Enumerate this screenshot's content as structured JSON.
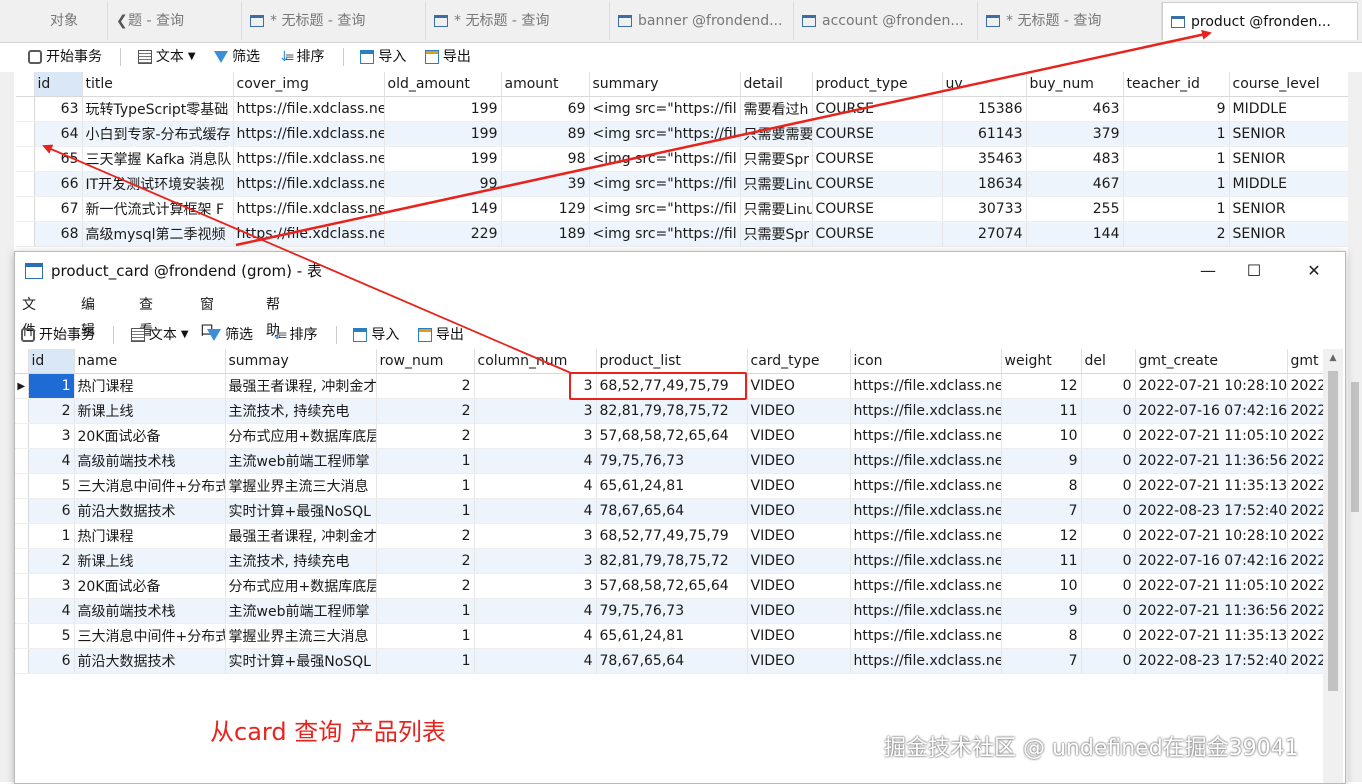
{
  "tabs": [
    {
      "label": "对象"
    },
    {
      "label": "题 - 查询"
    },
    {
      "label": "* 无标题 - 查询"
    },
    {
      "label": "* 无标题 - 查询"
    },
    {
      "label": "banner @frondend..."
    },
    {
      "label": "account @fronden..."
    },
    {
      "label": "* 无标题 - 查询"
    },
    {
      "label": "product @fronden..."
    }
  ],
  "toolbar": {
    "begin": "开始事务",
    "text": "文本",
    "filter": "筛选",
    "sort": "排序",
    "import": "导入",
    "export": "导出"
  },
  "product_table": {
    "columns": [
      "id",
      "title",
      "cover_img",
      "old_amount",
      "amount",
      "summary",
      "detail",
      "product_type",
      "uv",
      "buy_num",
      "teacher_id",
      "course_level"
    ],
    "rows": [
      [
        "63",
        "玩转TypeScript零基础",
        "https://file.xdclass.ne",
        "199",
        "69",
        "<img src=\"https://fil",
        "需要看过h",
        "COURSE",
        "15386",
        "463",
        "9",
        "MIDDLE"
      ],
      [
        "64",
        "小白到专家-分布式缓存",
        "https://file.xdclass.ne",
        "199",
        "89",
        "<img src=\"https://fil",
        "只需要需要看",
        "COURSE",
        "61143",
        "379",
        "1",
        "SENIOR"
      ],
      [
        "65",
        "三天掌握 Kafka 消息队",
        "https://file.xdclass.ne",
        "199",
        "98",
        "<img src=\"https://fil",
        "只需要Spr",
        "COURSE",
        "35463",
        "483",
        "1",
        "SENIOR"
      ],
      [
        "66",
        "IT开发测试环境安装视",
        "https://file.xdclass.ne",
        "99",
        "39",
        "<img src=\"https://fil",
        "只需要Linu",
        "COURSE",
        "18634",
        "467",
        "1",
        "MIDDLE"
      ],
      [
        "67",
        "新一代流式计算框架 F",
        "https://file.xdclass.ne",
        "149",
        "129",
        "<img src=\"https://fil",
        "只需要Linu",
        "COURSE",
        "30733",
        "255",
        "1",
        "SENIOR"
      ],
      [
        "68",
        "高级mysql第二季视频",
        "https://file.xdclass.ne",
        "229",
        "189",
        "<img src=\"https://fil",
        "只需要Spr",
        "COURSE",
        "27074",
        "144",
        "2",
        "SENIOR"
      ]
    ]
  },
  "window": {
    "title": "product_card @frondend (grom) - 表",
    "menu": [
      "文件",
      "编辑",
      "查看",
      "窗口",
      "帮助"
    ],
    "controls": {
      "minimize": "—",
      "maximize": "☐",
      "close": "✕"
    }
  },
  "card_table": {
    "columns": [
      "id",
      "name",
      "summay",
      "row_num",
      "column_num",
      "product_list",
      "card_type",
      "icon",
      "weight",
      "del",
      "gmt_create",
      "gmt"
    ],
    "rows": [
      [
        "1",
        "热门课程",
        "最强王者课程, 冲刺金才",
        "2",
        "3",
        "68,52,77,49,75,79",
        "VIDEO",
        "https://file.xdclass.ne",
        "12",
        "0",
        "2022-07-21 10:28:10",
        "2022"
      ],
      [
        "2",
        "新课上线",
        "主流技术, 持续充电",
        "2",
        "3",
        "82,81,79,78,75,72",
        "VIDEO",
        "https://file.xdclass.ne",
        "11",
        "0",
        "2022-07-16 07:42:16",
        "2022"
      ],
      [
        "3",
        "20K面试必备",
        "分布式应用+数据库底层",
        "2",
        "3",
        "57,68,58,72,65,64",
        "VIDEO",
        "https://file.xdclass.ne",
        "10",
        "0",
        "2022-07-21 11:05:10",
        "2022"
      ],
      [
        "4",
        "高级前端技术栈",
        "主流web前端工程师掌",
        "1",
        "4",
        "79,75,76,73",
        "VIDEO",
        "https://file.xdclass.ne",
        "9",
        "0",
        "2022-07-21 11:36:56",
        "2022"
      ],
      [
        "5",
        "三大消息中间件+分布式",
        "掌握业界主流三大消息",
        "1",
        "4",
        "65,61,24,81",
        "VIDEO",
        "https://file.xdclass.ne",
        "8",
        "0",
        "2022-07-21 11:35:13",
        "2022"
      ],
      [
        "6",
        "前沿大数据技术",
        "实时计算+最强NoSQL",
        "1",
        "4",
        "78,67,65,64",
        "VIDEO",
        "https://file.xdclass.ne",
        "7",
        "0",
        "2022-08-23 17:52:40",
        "2022"
      ],
      [
        "1",
        "热门课程",
        "最强王者课程, 冲刺金才",
        "2",
        "3",
        "68,52,77,49,75,79",
        "VIDEO",
        "https://file.xdclass.ne",
        "12",
        "0",
        "2022-07-21 10:28:10",
        "2022"
      ],
      [
        "2",
        "新课上线",
        "主流技术, 持续充电",
        "2",
        "3",
        "82,81,79,78,75,72",
        "VIDEO",
        "https://file.xdclass.ne",
        "11",
        "0",
        "2022-07-16 07:42:16",
        "2022"
      ],
      [
        "3",
        "20K面试必备",
        "分布式应用+数据库底层",
        "2",
        "3",
        "57,68,58,72,65,64",
        "VIDEO",
        "https://file.xdclass.ne",
        "10",
        "0",
        "2022-07-21 11:05:10",
        "2022"
      ],
      [
        "4",
        "高级前端技术栈",
        "主流web前端工程师掌",
        "1",
        "4",
        "79,75,76,73",
        "VIDEO",
        "https://file.xdclass.ne",
        "9",
        "0",
        "2022-07-21 11:36:56",
        "2022"
      ],
      [
        "5",
        "三大消息中间件+分布式",
        "掌握业界主流三大消息",
        "1",
        "4",
        "65,61,24,81",
        "VIDEO",
        "https://file.xdclass.ne",
        "8",
        "0",
        "2022-07-21 11:35:13",
        "2022"
      ],
      [
        "6",
        "前沿大数据技术",
        "实时计算+最强NoSQL",
        "1",
        "4",
        "78,67,65,64",
        "VIDEO",
        "https://file.xdclass.ne",
        "7",
        "0",
        "2022-08-23 17:52:40",
        "2022"
      ]
    ]
  },
  "annotation": {
    "caption": "从card 查询 产品列表",
    "color": "#e8231c"
  },
  "watermark": "掘金技术社区 @ undefined在掘金39041"
}
